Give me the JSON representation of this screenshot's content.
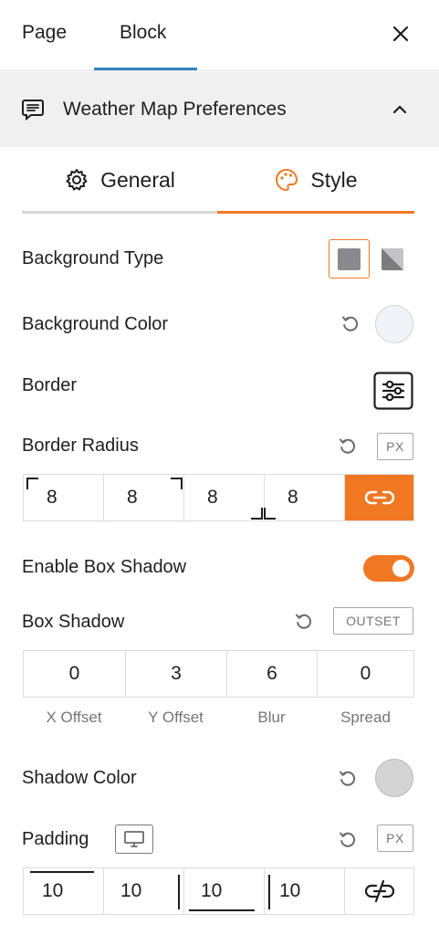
{
  "header_tabs": {
    "page": "Page",
    "block": "Block"
  },
  "panel": {
    "title": "Weather Map Preferences"
  },
  "style_tabs": {
    "general": "General",
    "style": "Style"
  },
  "background_type": {
    "label": "Background Type",
    "selected": "solid"
  },
  "background_color": {
    "label": "Background Color",
    "value": "#f0f4f8"
  },
  "border": {
    "label": "Border"
  },
  "border_radius": {
    "label": "Border Radius",
    "unit": "PX",
    "values": [
      "8",
      "8",
      "8",
      "8"
    ],
    "linked": true
  },
  "enable_box_shadow": {
    "label": "Enable Box Shadow",
    "enabled": true
  },
  "box_shadow": {
    "label": "Box Shadow",
    "mode": "OUTSET",
    "values": [
      "0",
      "3",
      "6",
      "0"
    ],
    "labels": [
      "X Offset",
      "Y Offset",
      "Blur",
      "Spread"
    ]
  },
  "shadow_color": {
    "label": "Shadow Color",
    "value": "#d4d4d4"
  },
  "padding": {
    "label": "Padding",
    "unit": "PX",
    "values": [
      "10",
      "10",
      "10",
      "10"
    ],
    "linked": false
  },
  "colors": {
    "accent": "#f07823",
    "tab_indicator": "#3582c4"
  }
}
